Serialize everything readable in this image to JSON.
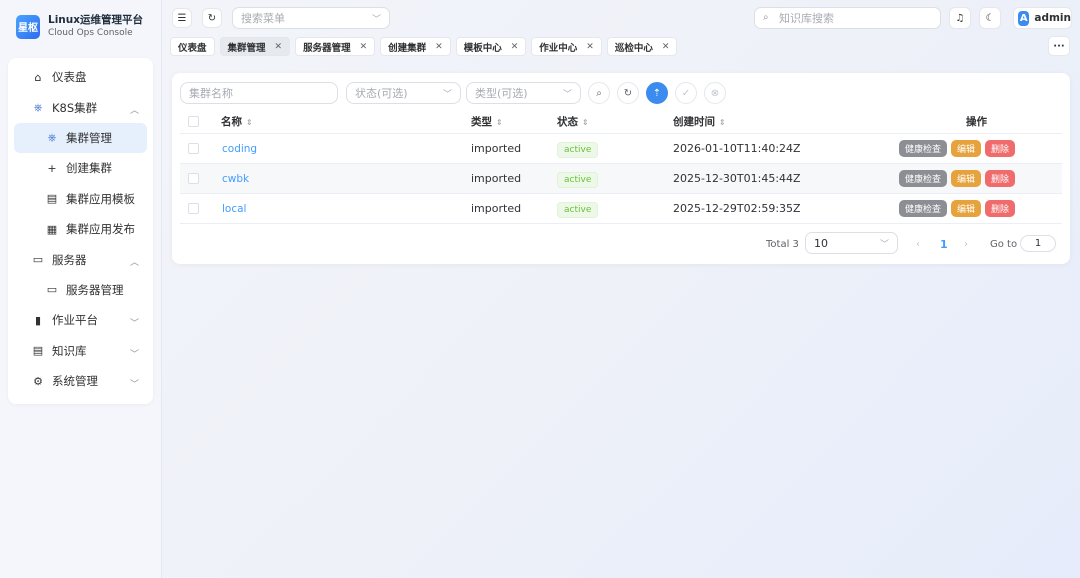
{
  "brand": {
    "logo_text": "星枢",
    "title": "Linux运维管理平台",
    "subtitle": "Cloud Ops Console"
  },
  "sidebar": {
    "items": [
      {
        "label": "仪表盘",
        "icon": "home-icon"
      },
      {
        "label": "K8S集群",
        "icon": "k8s-icon",
        "expanded": true
      },
      {
        "label": "集群管理",
        "icon": "cluster-icon",
        "active": true
      },
      {
        "label": "创建集群",
        "icon": "plus-icon"
      },
      {
        "label": "集群应用模板",
        "icon": "template-icon"
      },
      {
        "label": "集群应用发布",
        "icon": "publish-icon"
      },
      {
        "label": "服务器",
        "icon": "monitor-icon",
        "expanded": true
      },
      {
        "label": "服务器管理",
        "icon": "monitor-icon"
      },
      {
        "label": "作业平台",
        "icon": "book-icon",
        "expanded": false
      },
      {
        "label": "知识库",
        "icon": "doc-icon",
        "expanded": false
      },
      {
        "label": "系统管理",
        "icon": "gear-icon",
        "expanded": false
      }
    ]
  },
  "header": {
    "menu_search_placeholder": "搜索菜单",
    "kb_search_placeholder": "知识库搜索",
    "user": {
      "avatar": "A",
      "name": "admin"
    }
  },
  "tabs": [
    {
      "label": "仪表盘",
      "closable": false
    },
    {
      "label": "集群管理",
      "closable": true,
      "active": true
    },
    {
      "label": "服务器管理",
      "closable": true
    },
    {
      "label": "创建集群",
      "closable": true
    },
    {
      "label": "模板中心",
      "closable": true
    },
    {
      "label": "作业中心",
      "closable": true
    },
    {
      "label": "巡检中心",
      "closable": true
    }
  ],
  "filters": {
    "name_placeholder": "集群名称",
    "status_placeholder": "状态(可选)",
    "type_placeholder": "类型(可选)"
  },
  "table": {
    "columns": {
      "name": "名称",
      "type": "类型",
      "status": "状态",
      "created": "创建时间",
      "actions": "操作"
    },
    "rows": [
      {
        "name": "coding",
        "type": "imported",
        "status": "active",
        "created": "2026-01-10T11:40:24Z"
      },
      {
        "name": "cwbk",
        "type": "imported",
        "status": "active",
        "created": "2025-12-30T01:45:44Z"
      },
      {
        "name": "local",
        "type": "imported",
        "status": "active",
        "created": "2025-12-29T02:59:35Z"
      }
    ],
    "actions": {
      "health": "健康检查",
      "edit": "编辑",
      "delete": "删除"
    }
  },
  "pagination": {
    "total": "Total 3",
    "page_size": "10",
    "current_page": "1",
    "goto_label": "Go to",
    "goto_value": "1"
  },
  "colors": {
    "primary": "#3c8cf0",
    "link": "#409eff",
    "success": "#67c23a",
    "warning": "#e6a23c",
    "danger": "#f06b6b"
  }
}
